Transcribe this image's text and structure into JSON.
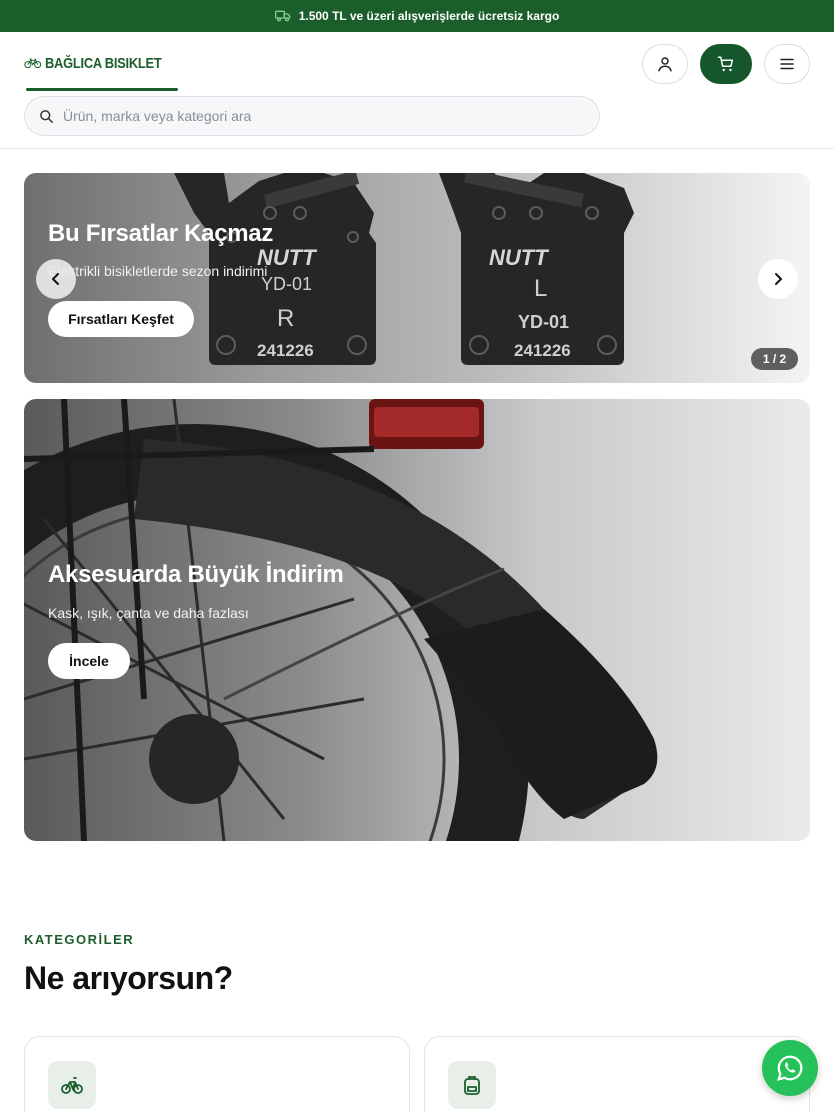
{
  "topbar": {
    "text": "1.500 TL ve üzeri alışverişlerde ücretsiz kargo",
    "icon": "truck-icon"
  },
  "header": {
    "logo_text": "BAĞLICA BISIKLET",
    "search_placeholder": "Ürün, marka veya kategori ara",
    "buttons": {
      "account": "user-icon",
      "cart": "cart-icon",
      "menu": "menu-icon"
    }
  },
  "hero": {
    "slides": [
      {
        "title": "Bu Fırsatlar Kaçmaz",
        "subtitle": "Elektrikli bisikletlerde sezon indirimi",
        "button": "Fırsatları Keşfet",
        "image_text": {
          "left_brand": "NUTT",
          "left_model": "YD-01",
          "left_side": "R",
          "left_code": "241226",
          "right_brand": "NUTT",
          "right_side": "L",
          "right_model": "YD-01",
          "right_code": "241226"
        }
      },
      {
        "title": "Aksesuarda Büyük İndirim",
        "subtitle": "Kask, ışık, çanta ve daha fazlası",
        "button": "İncele"
      }
    ],
    "counter": "1 / 2"
  },
  "categories": {
    "eyebrow": "KATEGORİLER",
    "heading": "Ne arıyorsun?",
    "cards": [
      {
        "icon": "bicycle-icon"
      },
      {
        "icon": "backpack-icon"
      }
    ]
  },
  "colors": {
    "brand_green": "#1b5e2b",
    "cart_green": "#15572a",
    "whatsapp_green": "#25c15a"
  },
  "floating": {
    "icon": "whatsapp-icon"
  }
}
